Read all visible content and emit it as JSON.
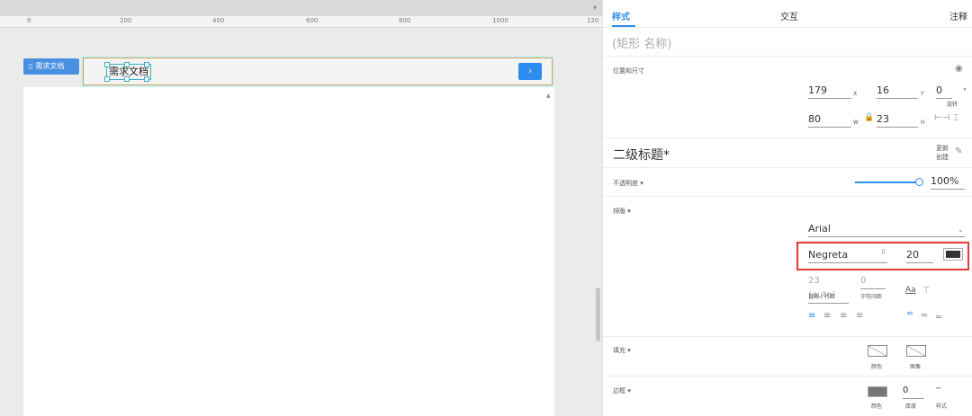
{
  "ruler": {
    "labels": [
      "0",
      "200",
      "400",
      "600",
      "800",
      "1000",
      "120"
    ]
  },
  "canvas": {
    "tag_button_label": "需求文档",
    "selected_text": "需求文档",
    "nav_arrow": "›"
  },
  "inspector": {
    "tabs": {
      "style": "样式",
      "interaction": "交互",
      "notes": "注释"
    },
    "shape_name_placeholder": "(矩形 名称)",
    "position_size": {
      "label": "位置和尺寸",
      "x": "179",
      "x_unit": "X",
      "y": "16",
      "y_unit": "Y",
      "rotation": "0",
      "rotation_unit": "°",
      "rotation_label": "旋转",
      "w": "80",
      "w_unit": "W",
      "h": "23",
      "h_unit": "H"
    },
    "style_name": "二级标题*",
    "update_create": {
      "line1": "更新",
      "line2": "创建"
    },
    "opacity": {
      "label": "不透明度 ▾",
      "value": "100%"
    },
    "typography": {
      "label": "排版 ▾",
      "font_family": "Arial",
      "font_weight": "Negreta",
      "font_size": "20",
      "line_height": "23 (auto)",
      "line_height_label": "直线 / 行距",
      "letter_spacing": "0",
      "letter_spacing_label": "字符间距",
      "case_icon_label": "Aa",
      "color": "#333333"
    },
    "fill": {
      "label": "填充 ▾",
      "color_label": "颜色",
      "image_label": "图像"
    },
    "border": {
      "label": "边框 ▾",
      "color_label": "颜色",
      "thickness": "0",
      "thickness_label": "厚度",
      "style_label": "样式",
      "color": "#777777"
    },
    "accent": "#2d8cf0",
    "highlight": "#e53935"
  }
}
